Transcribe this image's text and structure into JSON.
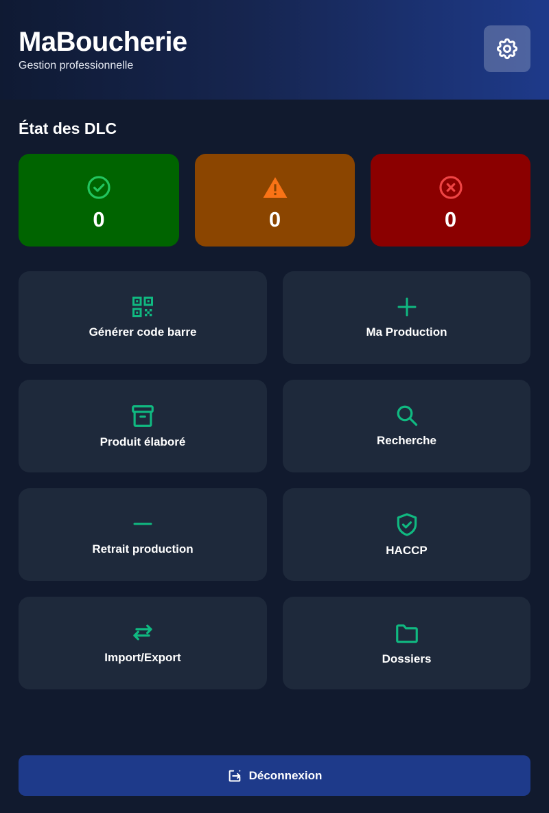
{
  "header": {
    "title": "MaBoucherie",
    "subtitle": "Gestion professionnelle",
    "settings_icon": "gear-icon"
  },
  "dlc": {
    "title": "État des DLC",
    "cards": [
      {
        "status": "ok",
        "icon": "check-circle-icon",
        "count": "0",
        "color": "#006400",
        "icon_color": "#22c55e"
      },
      {
        "status": "warning",
        "icon": "warning-triangle-icon",
        "count": "0",
        "color": "#8b4500",
        "icon_color": "#f97316"
      },
      {
        "status": "expired",
        "icon": "x-circle-icon",
        "count": "0",
        "color": "#8b0000",
        "icon_color": "#ef4444"
      }
    ]
  },
  "tiles": [
    {
      "icon": "qr-code-icon",
      "label": "Générer code barre"
    },
    {
      "icon": "plus-icon",
      "label": "Ma Production"
    },
    {
      "icon": "archive-box-icon",
      "label": "Produit élaboré"
    },
    {
      "icon": "search-icon",
      "label": "Recherche"
    },
    {
      "icon": "minus-icon",
      "label": "Retrait production"
    },
    {
      "icon": "shield-check-icon",
      "label": "HACCP"
    },
    {
      "icon": "arrows-swap-icon",
      "label": "Import/Export"
    },
    {
      "icon": "folder-icon",
      "label": "Dossiers"
    }
  ],
  "accent_color": "#10b981",
  "logout": {
    "label": "Déconnexion",
    "icon": "logout-icon"
  }
}
